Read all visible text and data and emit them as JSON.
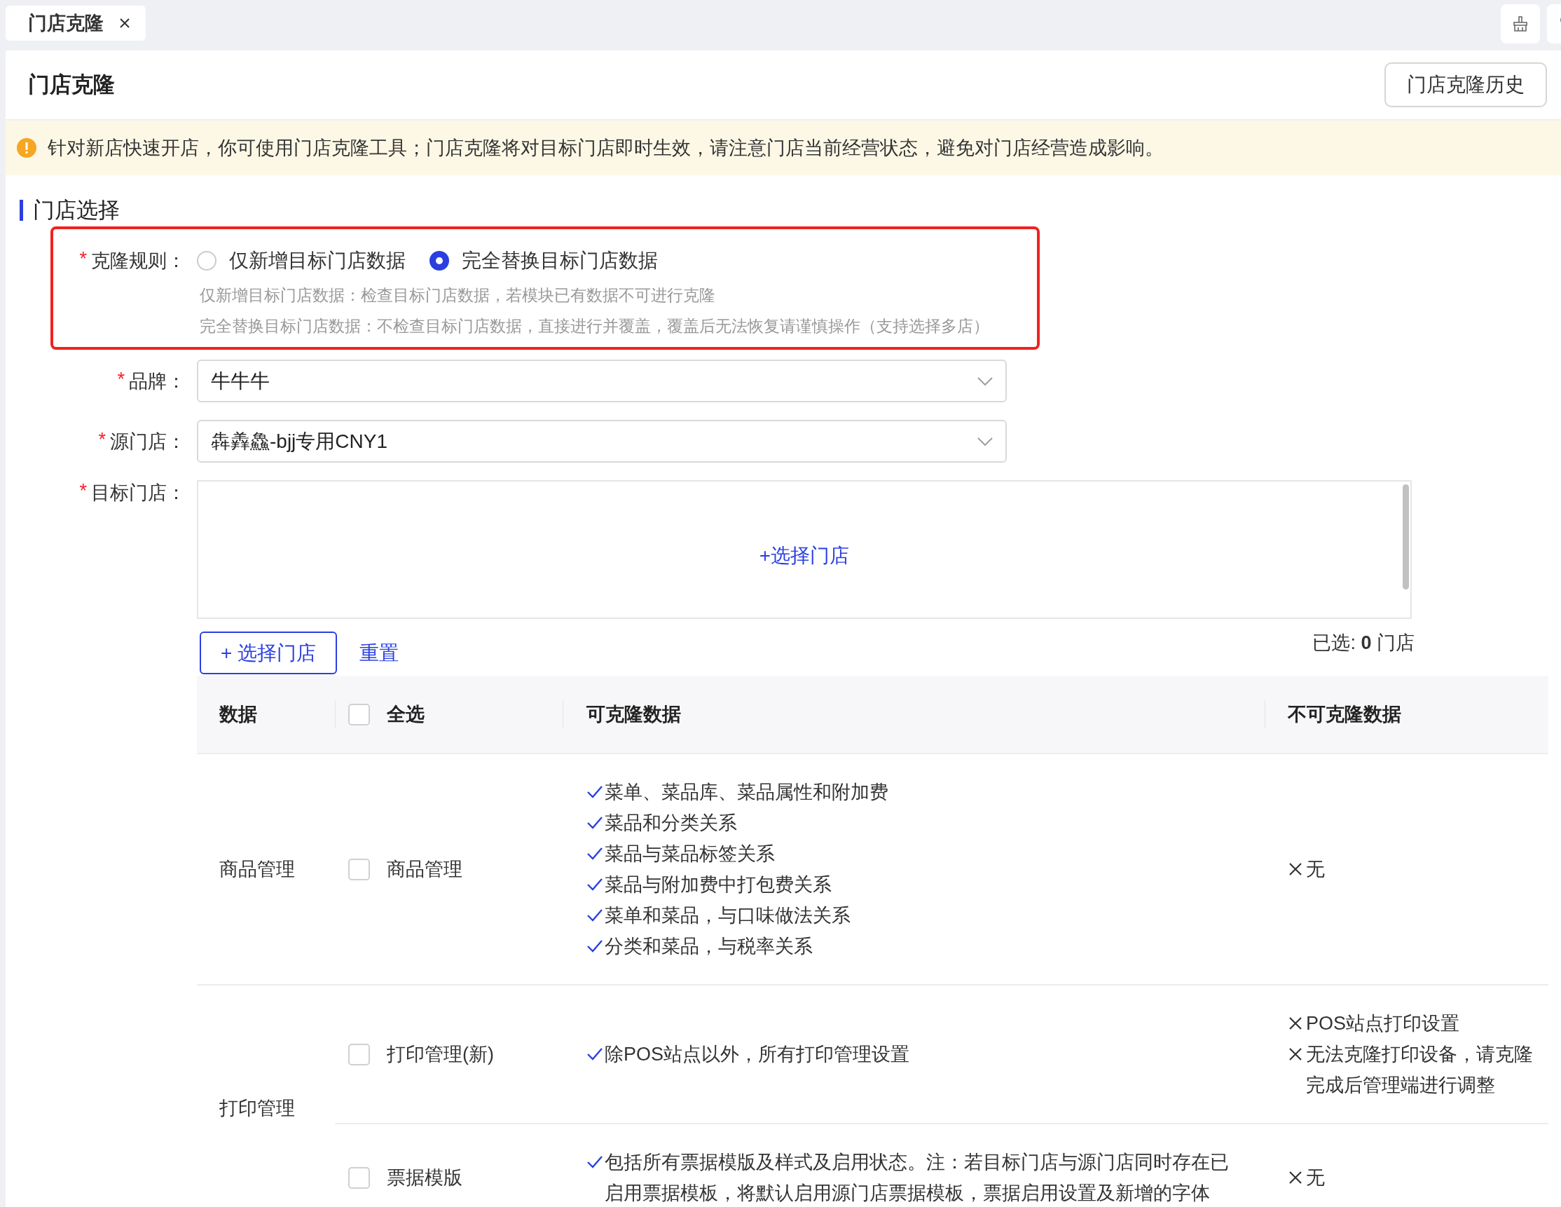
{
  "tab_bar": {
    "tabs": [
      {
        "label": "门店克隆",
        "selected": true
      }
    ]
  },
  "page": {
    "title": "门店克隆",
    "history_button": "门店克隆历史"
  },
  "notice": "针对新店快速开店，你可使用门店克隆工具；门店克隆将对目标门店即时生效，请注意门店当前经营状态，避免对门店经营造成影响。",
  "section_title": "门店选择",
  "form": {
    "clone_rule": {
      "label": "克隆规则：",
      "required_mark": "*",
      "highlighted": true,
      "options": [
        {
          "label": "仅新增目标门店数据",
          "selected": false
        },
        {
          "label": "完全替换目标门店数据",
          "selected": true
        }
      ],
      "hints": [
        "仅新增目标门店数据：检查目标门店数据，若模块已有数据不可进行克隆",
        "完全替换目标门店数据：不检查目标门店数据，直接进行并覆盖，覆盖后无法恢复请谨慎操作（支持选择多店）"
      ]
    },
    "brand": {
      "label": "品牌：",
      "required_mark": "*",
      "value": "牛牛牛"
    },
    "source_store": {
      "label": "源门店：",
      "required_mark": "*",
      "value": "犇羴鱻-bjj专用CNY1"
    },
    "target_store": {
      "label": "目标门店：",
      "required_mark": "*",
      "add_link": "+选择门店"
    }
  },
  "actions": {
    "select_button": "+ 选择门店",
    "reset_link": "重置",
    "selected_count": "已选: **0** 门店"
  },
  "table": {
    "columns": [
      "数据",
      "可克隆数据",
      "不可克隆数据"
    ],
    "select_all": {
      "label": "全选",
      "checked": false
    },
    "groups": [
      {
        "name": "商品管理",
        "rows": [
          {
            "label": "商品管理",
            "checked": false,
            "clonable": [
              "菜单、菜品库、菜品属性和附加费",
              "菜品和分类关系",
              "菜品与菜品标签关系",
              "菜品与附加费中打包费关系",
              "菜单和菜品，与口味做法关系",
              "分类和菜品，与税率关系"
            ],
            "not_clonable": [
              "无"
            ]
          }
        ]
      },
      {
        "name": "打印管理",
        "rows": [
          {
            "label": "打印管理(新)",
            "checked": false,
            "clonable": [
              "除POS站点以外，所有打印管理设置"
            ],
            "not_clonable": [
              "POS站点打印设置",
              "无法克隆打印设备，请克隆完成后管理端进行调整"
            ]
          },
          {
            "label": "票据模版",
            "checked": false,
            "clonable": [
              "包括所有票据模版及样式及启用状态。注：若目标门店与源门店同时存在已启用票据模板，将默认启用源门店票据模板，票据启用设置及新增的字体"
            ],
            "not_clonable": [
              "无"
            ]
          }
        ]
      }
    ]
  }
}
